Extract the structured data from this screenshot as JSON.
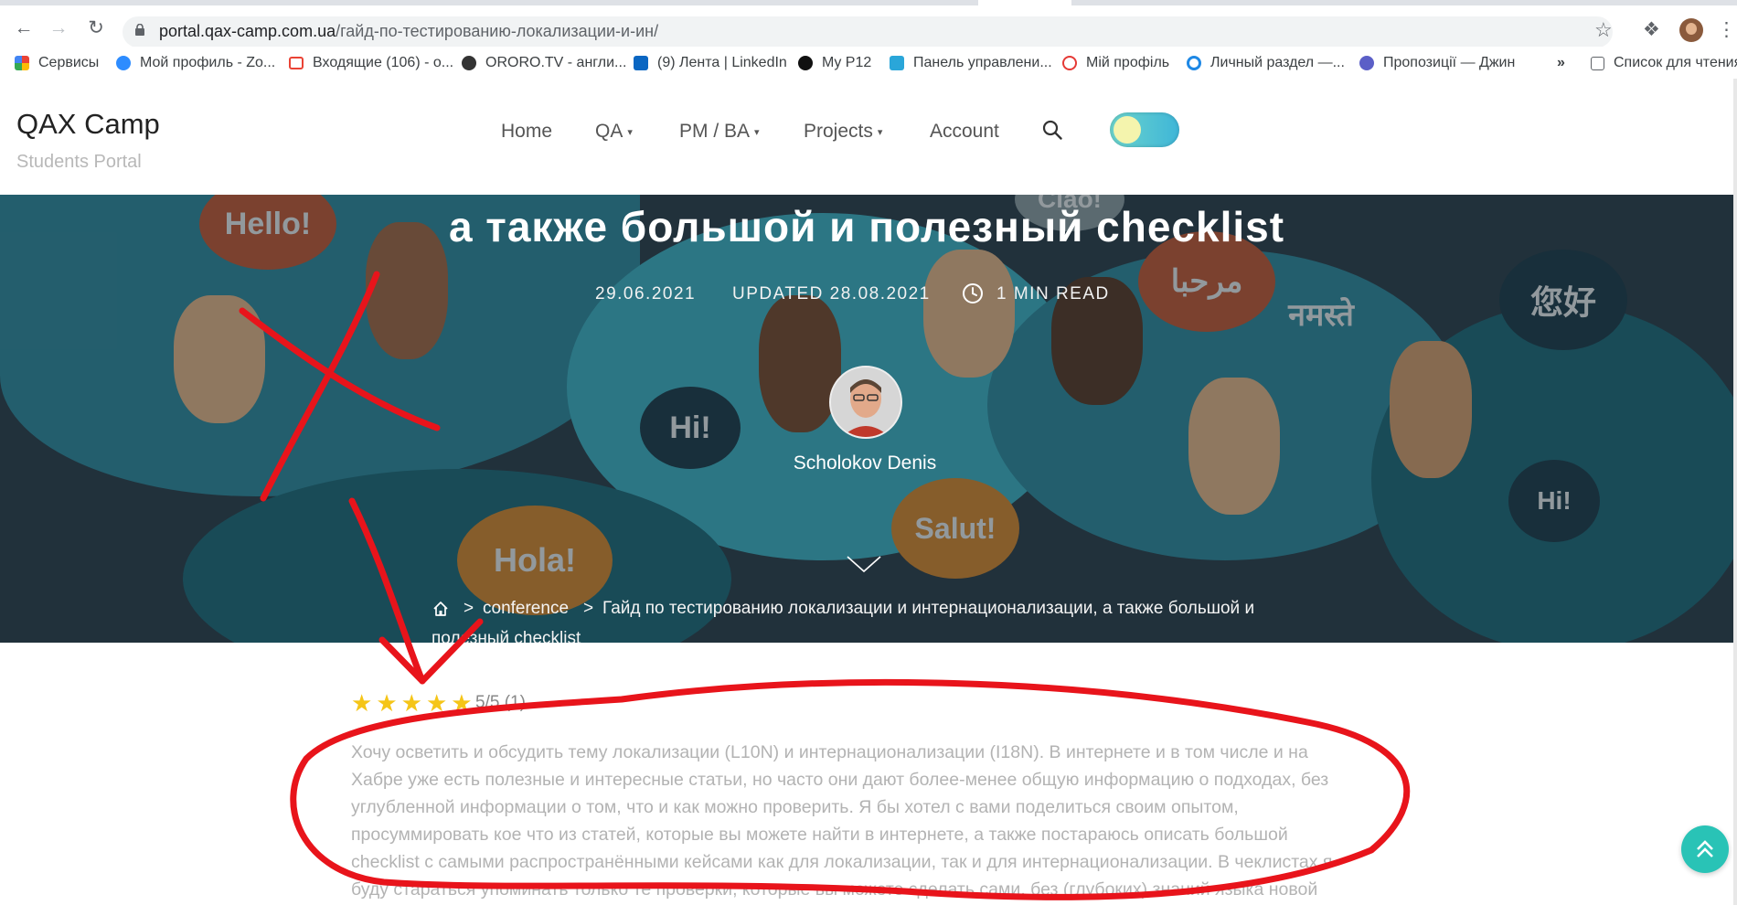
{
  "browser": {
    "url_host": "portal.qax-camp.com.ua",
    "url_path": "/гайд-по-тестированию-локализации-и-ин/",
    "bookmarks": [
      {
        "label": "Сервисы",
        "color": "#4285f4"
      },
      {
        "label": "Мой профиль - Zo...",
        "color": "#2d8cff"
      },
      {
        "label": "Входящие (106) - о...",
        "color": "#ea4335"
      },
      {
        "label": "ORORO.TV - англи...",
        "color": "#333333"
      },
      {
        "label": "(9) Лента | LinkedIn",
        "color": "#0a66c2"
      },
      {
        "label": "My P12",
        "color": "#111111"
      },
      {
        "label": "Панель управлени...",
        "color": "#2aa6d9"
      },
      {
        "label": "Мій профіль",
        "color": "#e53935"
      },
      {
        "label": "Личный раздел —...",
        "color": "#1e88e5"
      },
      {
        "label": "Пропозиції — Джин",
        "color": "#5b5fc7"
      }
    ],
    "more_bookmarks": "»",
    "reading_list": "Список для чтения"
  },
  "site": {
    "logo": "QAX Camp",
    "tagline": "Students Portal",
    "menu": [
      {
        "label": "Home",
        "dropdown": false
      },
      {
        "label": "QA",
        "dropdown": true
      },
      {
        "label": "PM / BA",
        "dropdown": true
      },
      {
        "label": "Projects",
        "dropdown": true
      },
      {
        "label": "Account",
        "dropdown": false
      }
    ],
    "dropdown_caret": "▾"
  },
  "hero": {
    "title_line": "а также большой и полезный checklist",
    "date": "29.06.2021",
    "updated": "UPDATED 28.08.2021",
    "read_time": "1 MIN READ",
    "author": "Scholokov Denis",
    "bubbles": [
      "Hello!",
      "Hi!",
      "Hola!",
      "Salut!",
      "مرحبا",
      "नमस्ते",
      "您好",
      "Hi!",
      "Ciao!"
    ]
  },
  "breadcrumb": {
    "separator": ">",
    "category": "conference",
    "current_line1": "Гайд по тестированию локализации и интернационализации, а также большой и",
    "current_line2": "полезный checklist"
  },
  "rating": {
    "stars": 5,
    "star_glyph": "★",
    "text": "5/5 (1)"
  },
  "article": {
    "lines": [
      "Хочу осветить и обсудить тему локализации (L10N) и интернационализации (I18N). В интернете и в том числе и на",
      "Хабре уже есть полезные и интересные статьи, но часто они дают более-менее общую информацию о подходах, без",
      "углубленной информации о том, что и как можно проверить. Я бы хотел с вами поделиться своим опытом,",
      "просуммировать кое что из статей, которые вы можете найти в интернете, а также постараюсь описать большой",
      "checklist с самыми распространёнными кейсами как для локализации, так и для интернационализации. В чеклистах я",
      "буду стараться упоминать только те проверки, которые вы можете сделать сами, без (глубоких) знаний языка новой"
    ]
  },
  "colors": {
    "accent": "#29c3b6",
    "annotation": "#e8141b",
    "star": "#f5c518"
  }
}
